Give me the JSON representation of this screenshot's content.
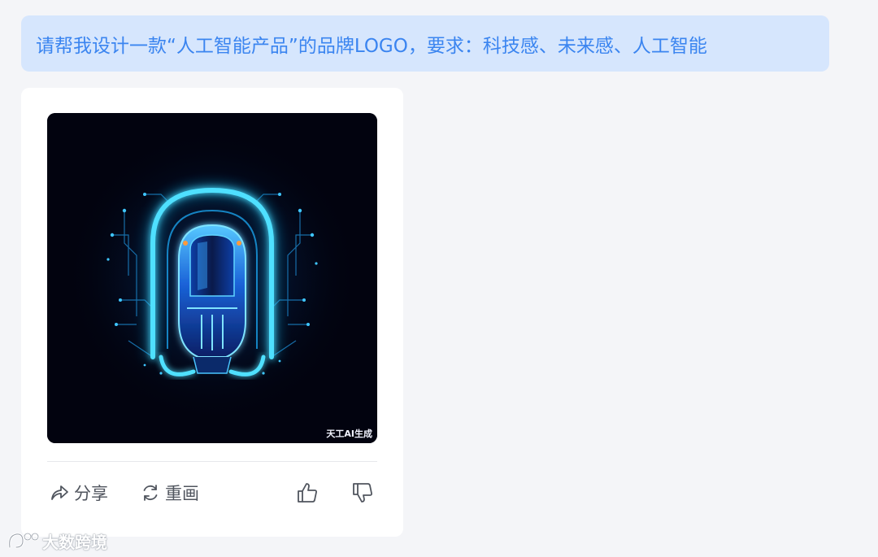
{
  "chat": {
    "user_prompt": "请帮我设计一款“人工智能产品”的品牌LOGO，要求：科技感、未来感、人工智能"
  },
  "result": {
    "image": {
      "description_icon": "robot-head-logo-image",
      "watermark": "天工AI生成",
      "background_color": "#02030f",
      "glow_color": "#16c8ff"
    },
    "actions": {
      "share_label": "分享",
      "redraw_label": "重画",
      "like_icon": "thumbs-up-icon",
      "dislike_icon": "thumbs-down-icon"
    }
  },
  "watermark": {
    "text": "大数跨境"
  },
  "colors": {
    "page_bg": "#f4f5f8",
    "bubble_bg": "#d6e6fd",
    "bubble_text": "#3b85f0",
    "card_bg": "#ffffff",
    "action_text": "#50555e"
  }
}
